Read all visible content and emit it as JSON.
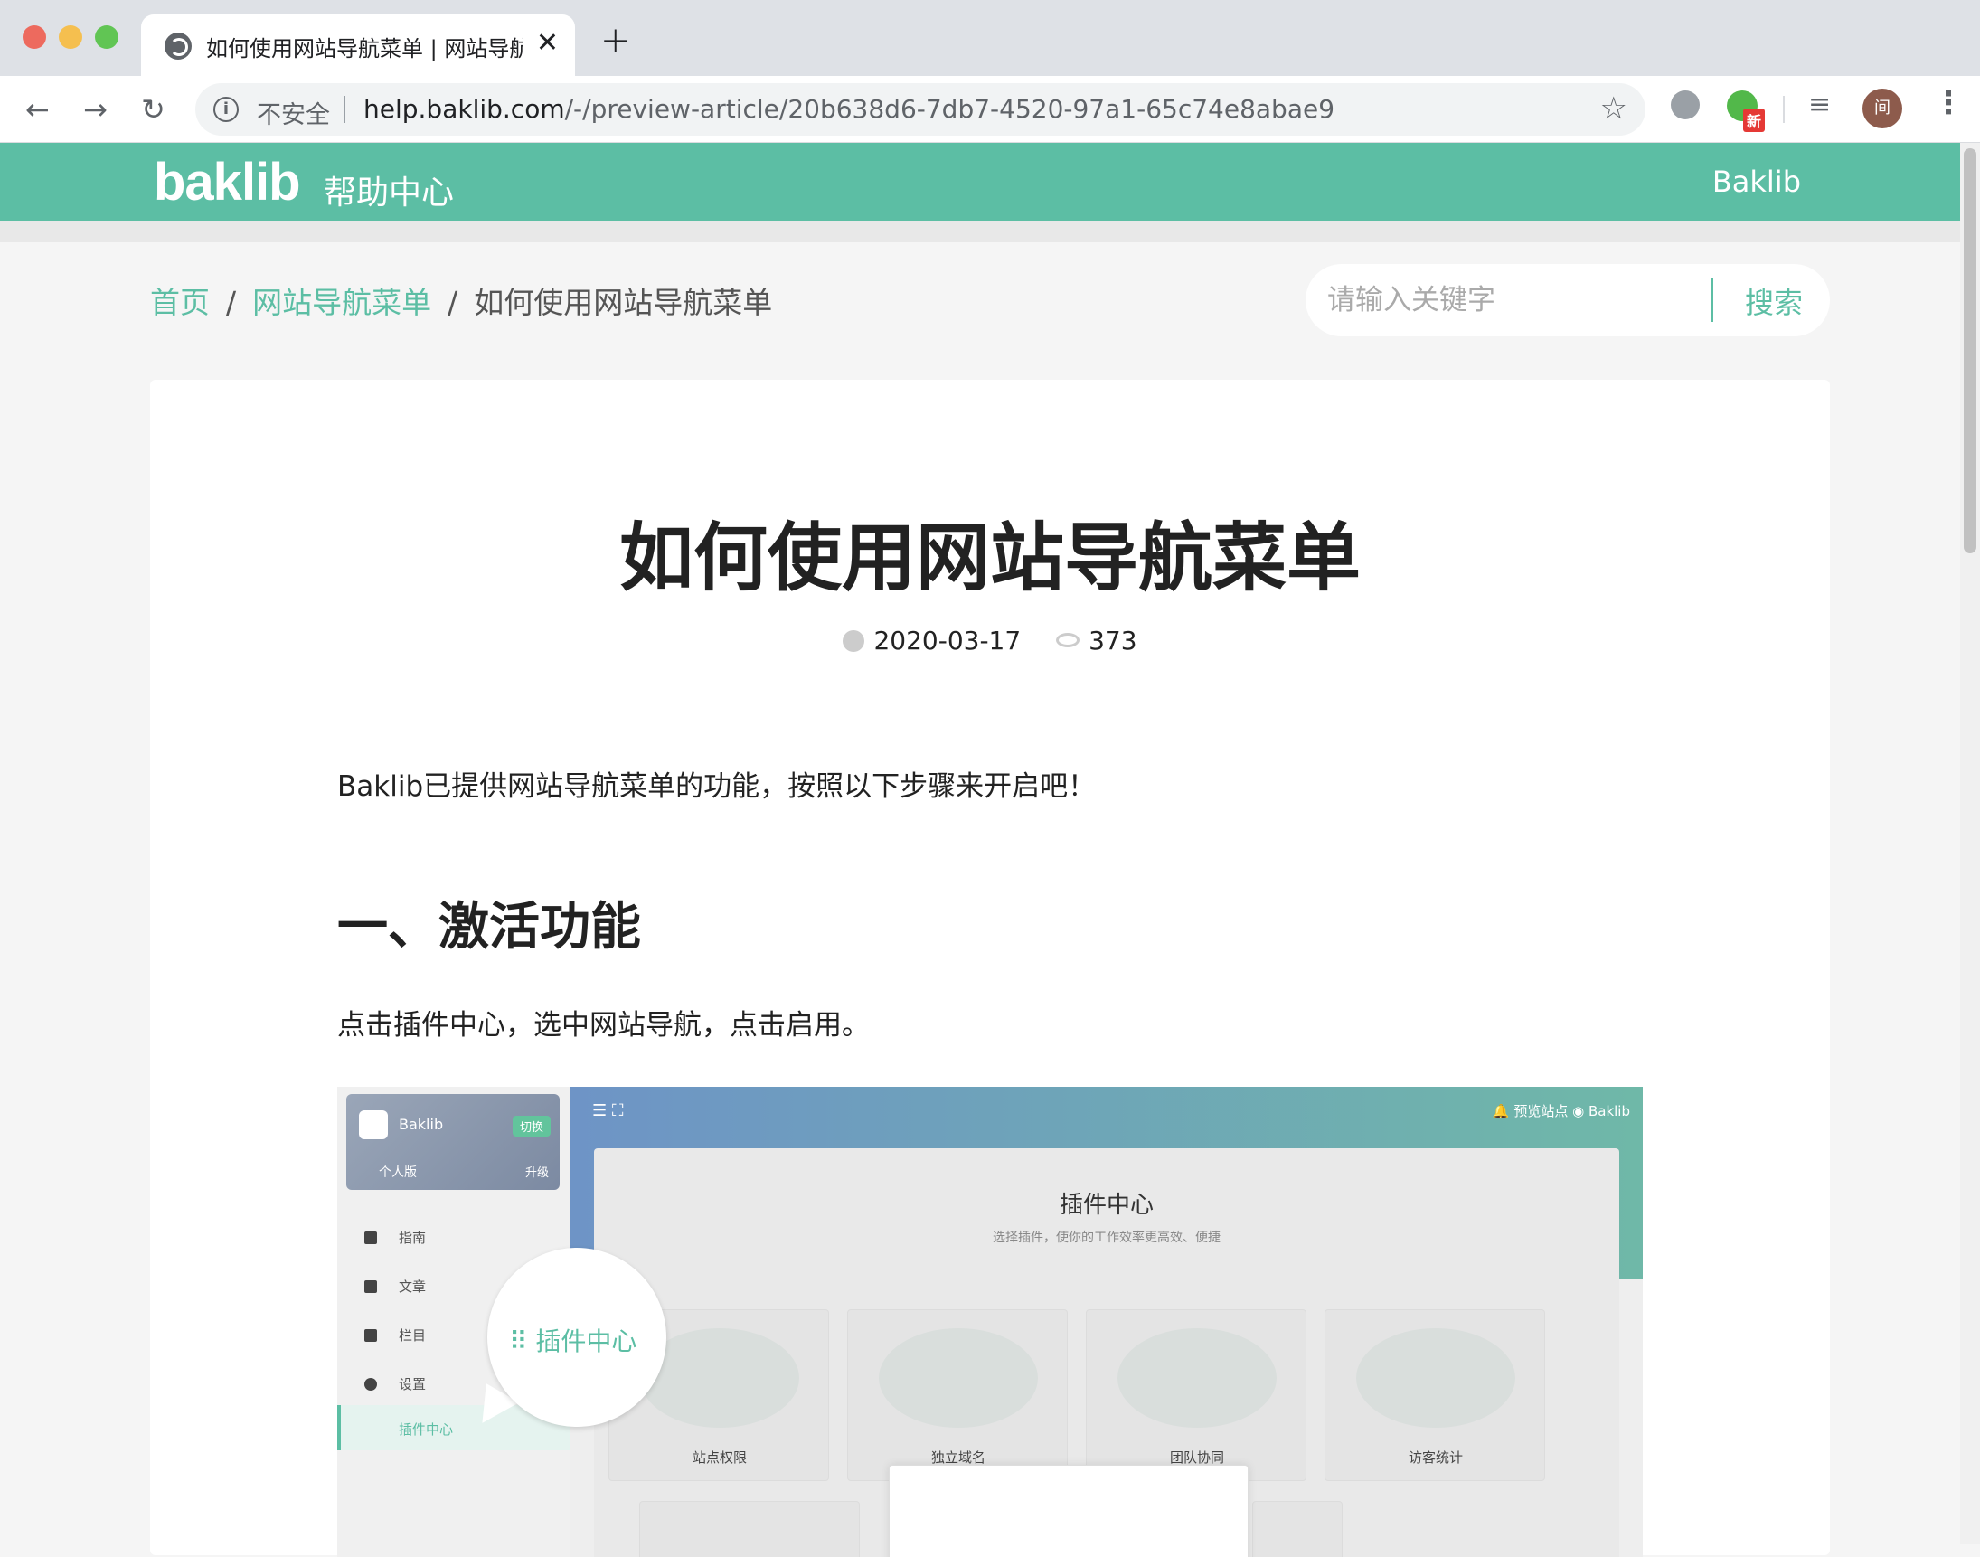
{
  "browser": {
    "tab_title": "如何使用网站导航菜单 | 网站导航菜单",
    "tab_close": "✕",
    "new_tab": "+",
    "security_label": "不安全",
    "url_host": "help.baklib.com",
    "url_path": "/-/preview-article/20b638d6-7db7-4520-97a1-65c74e8abae9",
    "extension_badge": "新",
    "avatar_initial": "间"
  },
  "site": {
    "logo": "baklib",
    "logo_sub": "帮助中心",
    "header_right": "Baklib",
    "accent_color": "#5cbea4"
  },
  "breadcrumb": {
    "home": "首页",
    "category": "网站导航菜单",
    "current": "如何使用网站导航菜单",
    "separator": "/"
  },
  "search": {
    "placeholder": "请输入关键字",
    "button_label": "搜索"
  },
  "article": {
    "title": "如何使用网站导航菜单",
    "date": "2020-03-17",
    "views": "373",
    "intro": "Baklib已提供网站导航菜单的功能，按照以下步骤来开启吧！",
    "section_heading": "一、激活功能",
    "section_text": "点击插件中心，选中网站导航，点击启用。"
  },
  "screenshot": {
    "brand": "Baklib",
    "switch_label": "切换",
    "edition": "个人版",
    "upgrade": "升级",
    "nav": [
      "指南",
      "文章",
      "栏目",
      "设置",
      "插件中心"
    ],
    "top_right": "预览站点",
    "top_right_brand": "Baklib",
    "panel_title": "插件中心",
    "panel_subtitle": "选择插件，使你的工作效率更高效、便捷",
    "plugins": [
      "站点权限",
      "独立域名",
      "团队协同",
      "访客统计"
    ],
    "bubble_label": "插件中心"
  }
}
